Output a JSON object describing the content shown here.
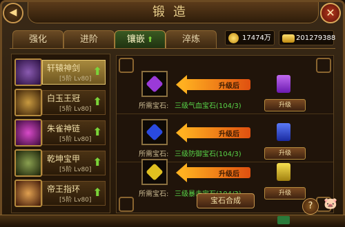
{
  "window": {
    "title": "锻造"
  },
  "tabs": [
    {
      "label": "强化",
      "active": false
    },
    {
      "label": "进阶",
      "active": false
    },
    {
      "label": "镶嵌",
      "active": true
    },
    {
      "label": "淬炼",
      "active": false
    }
  ],
  "currency": {
    "gold": {
      "value": "17474万",
      "icon": "gold-coin-icon"
    },
    "ingot": {
      "value": "201279388",
      "icon": "gold-ingot-icon"
    }
  },
  "equipment": [
    {
      "name": "轩辕神剑",
      "level": "[5阶 Lv80]",
      "selected": true,
      "icon": "sword-icon"
    },
    {
      "name": "白玉王冠",
      "level": "[5阶 Lv80]",
      "selected": false,
      "icon": "crown-icon"
    },
    {
      "name": "朱雀神链",
      "level": "[5阶 Lv80]",
      "selected": false,
      "icon": "necklace-icon"
    },
    {
      "name": "乾坤宝甲",
      "level": "[5阶 Lv80]",
      "selected": false,
      "icon": "armor-icon"
    },
    {
      "name": "帝王指环",
      "level": "[5阶 Lv80]",
      "selected": false,
      "icon": "ring-icon"
    }
  ],
  "gems": [
    {
      "required_label": "所需宝石:",
      "gem_name": "三级气血宝石(104/3)",
      "after_label": "升级后",
      "upgrade_label": "升级",
      "color": "#9a3ad8"
    },
    {
      "required_label": "所需宝石:",
      "gem_name": "三级防御宝石(104/3)",
      "after_label": "升级后",
      "upgrade_label": "升级",
      "color": "#2a4ae0"
    },
    {
      "required_label": "所需宝石:",
      "gem_name": "三级暴击宝石(104/3)",
      "after_label": "升级后",
      "upgrade_label": "升级",
      "color": "#e0c020"
    }
  ],
  "synthesize_label": "宝石合成",
  "close_icon": "close-icon",
  "help_icon": "question-icon"
}
